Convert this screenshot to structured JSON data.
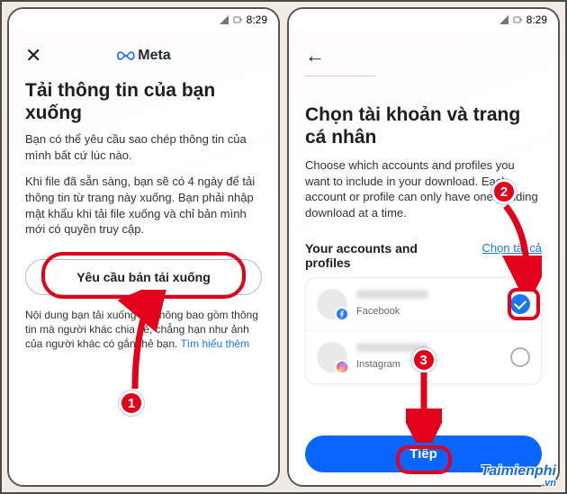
{
  "status": {
    "time": "8:29"
  },
  "left": {
    "logo_text": "Meta",
    "title": "Tải thông tin của bạn xuống",
    "intro": "Bạn có thể yêu cầu sao chép thông tin của mình bất cứ lúc nào.",
    "detail": "Khi file đã sẵn sàng, bạn sẽ có 4 ngày để tải thông tin từ trang này xuống. Bạn phải nhập mật khẩu khi tải file xuống và chỉ bản mình mới có quyền truy cập.",
    "request_btn": "Yêu cầu bản tải xuống",
    "note_pre": "Nội dung bạn tải xuống sẽ không bao gồm thông tin mà người khác chia sẻ, chẳng hạn như ảnh của người khác có gắn thẻ bạn. ",
    "note_link": "Tìm hiểu thêm"
  },
  "right": {
    "title": "Chọn tài khoản và trang cá nhân",
    "desc": "Choose which accounts and profiles you want to include in your download. Each account or profile can only have one pending download at a time.",
    "section_label": "Your accounts and profiles",
    "select_all": "Chọn tất cả",
    "accounts": [
      {
        "platform": "Facebook",
        "checked": true
      },
      {
        "platform": "Instagram",
        "checked": false
      }
    ],
    "continue_btn": "Tiếp"
  },
  "badges": {
    "b1": "1",
    "b2": "2",
    "b3": "3"
  },
  "watermark": {
    "main": "Taimienphi",
    "sub": ".vn"
  }
}
